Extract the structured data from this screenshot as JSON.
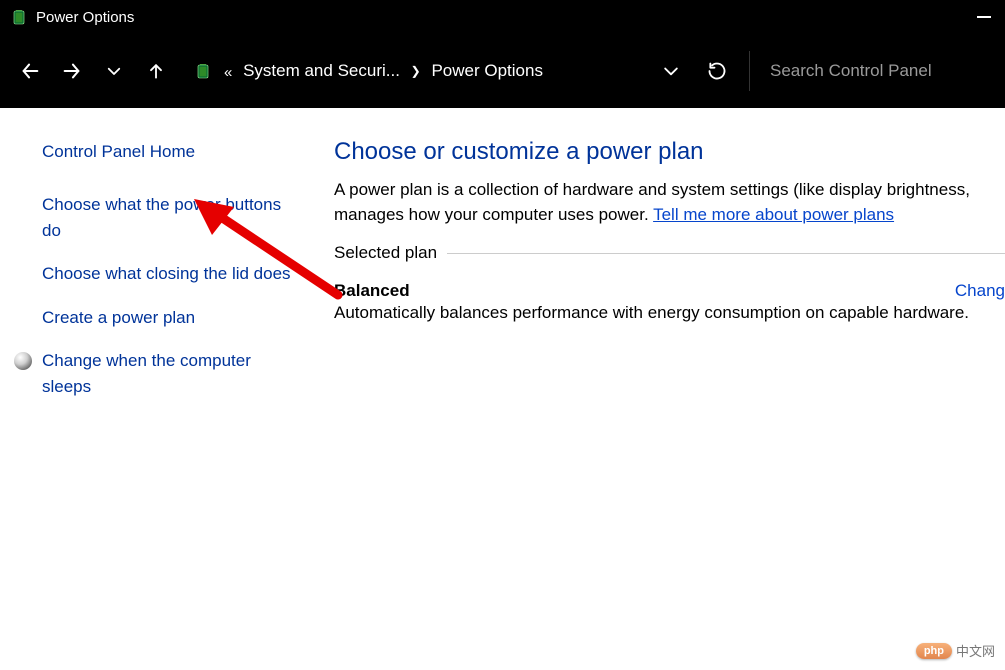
{
  "titlebar": {
    "title": "Power Options"
  },
  "breadcrumb": {
    "parent": "System and Securi...",
    "current": "Power Options"
  },
  "search": {
    "placeholder": "Search Control Panel"
  },
  "sidebar": {
    "home": "Control Panel Home",
    "links": {
      "power_buttons": "Choose what the power buttons do",
      "closing_lid": "Choose what closing the lid does",
      "create_plan": "Create a power plan",
      "change_sleep": "Change when the computer sleeps"
    }
  },
  "main": {
    "title": "Choose or customize a power plan",
    "desc_a": "A power plan is a collection of hardware and system settings (like display brightness,",
    "desc_b": "manages how your computer uses power. ",
    "help_link": "Tell me more about power plans",
    "section_label": "Selected plan",
    "plan_name": "Balanced",
    "plan_change": "Chang",
    "plan_desc": "Automatically balances performance with energy consumption on capable hardware."
  },
  "watermark": {
    "badge": "php",
    "text": "中文网"
  }
}
